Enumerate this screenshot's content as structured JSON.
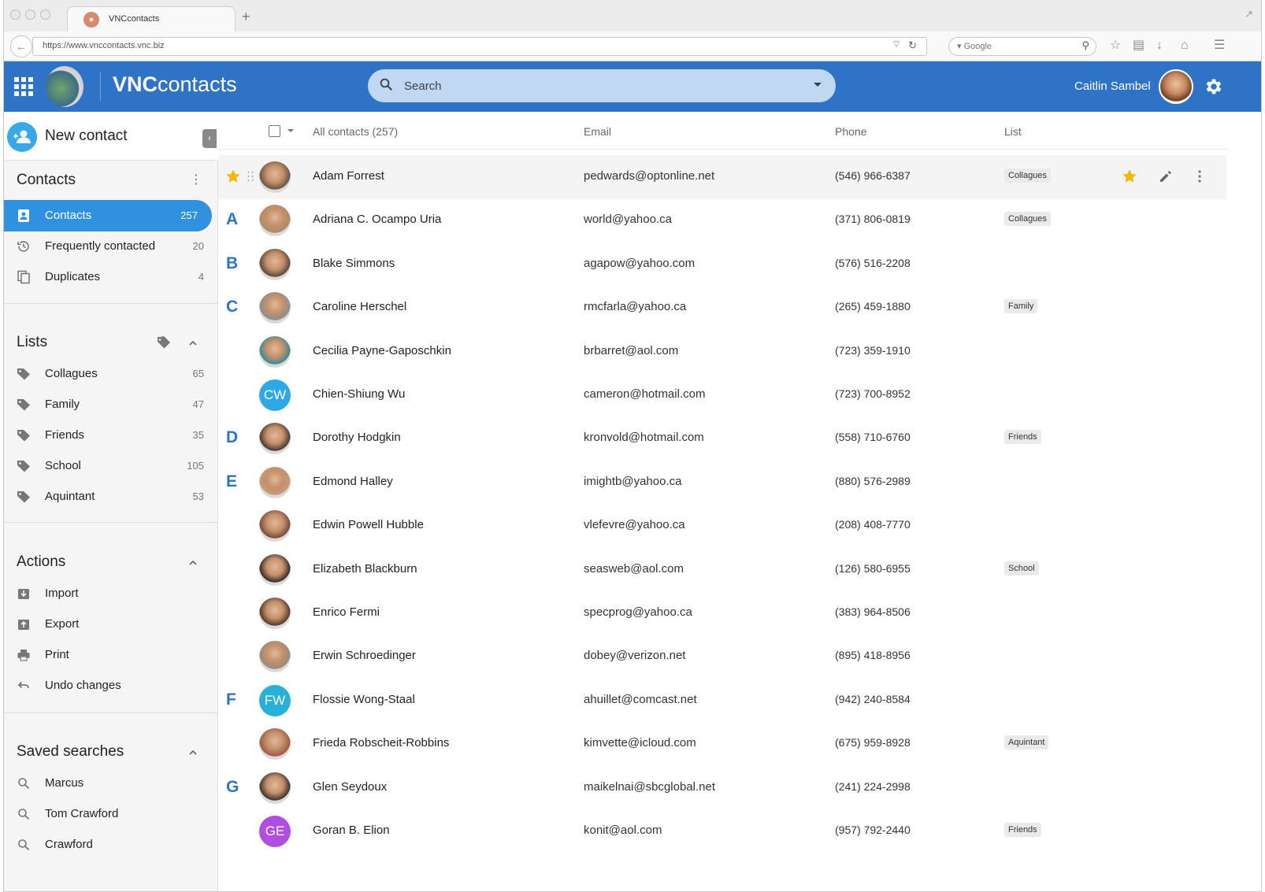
{
  "browser": {
    "tab_title": "VNCcontacts",
    "url": "https://www.vnccontacts.vnc.biz",
    "search_engine": "Google"
  },
  "header": {
    "app_title_bold": "VNC",
    "app_title_rest": "contacts",
    "search_placeholder": "Search",
    "user_name": "Caitlin Sambel",
    "brand_color": "#2f73c6"
  },
  "sidebar": {
    "new_contact_label": "New contact",
    "contacts_section": {
      "title": "Contacts",
      "items": [
        {
          "label": "Contacts",
          "count": "257",
          "icon": "contact-card-icon",
          "active": true
        },
        {
          "label": "Frequently contacted",
          "count": "20",
          "icon": "history-icon"
        },
        {
          "label": "Duplicates",
          "count": "4",
          "icon": "duplicate-icon"
        }
      ]
    },
    "lists_section": {
      "title": "Lists",
      "items": [
        {
          "label": "Collagues",
          "count": "65"
        },
        {
          "label": "Family",
          "count": "47"
        },
        {
          "label": "Friends",
          "count": "35"
        },
        {
          "label": "School",
          "count": "105"
        },
        {
          "label": "Aquintant",
          "count": "53"
        }
      ]
    },
    "actions_section": {
      "title": "Actions",
      "items": [
        {
          "label": "Import",
          "icon": "import-icon"
        },
        {
          "label": "Export",
          "icon": "export-icon"
        },
        {
          "label": "Print",
          "icon": "print-icon"
        },
        {
          "label": "Undo changes",
          "icon": "undo-icon"
        }
      ]
    },
    "saved_searches_section": {
      "title": "Saved searches",
      "items": [
        {
          "label": "Marcus"
        },
        {
          "label": "Tom Crawford"
        },
        {
          "label": "Crawford"
        }
      ]
    }
  },
  "table": {
    "headers": {
      "name": "All contacts (257)",
      "email": "Email",
      "phone": "Phone",
      "list": "List"
    },
    "rows": [
      {
        "letter": "",
        "name": "Adam Forrest",
        "email": "pedwards@optonline.net",
        "phone": "(546) 966-6387",
        "list": "Collagues",
        "avatar_initials": "",
        "avatar_color": "#6b5445",
        "starred": true
      },
      {
        "letter": "A",
        "name": "Adriana C. Ocampo Uria",
        "email": "world@yahoo.ca",
        "phone": "(371) 806-0819",
        "list": "Collagues",
        "avatar_initials": "",
        "avatar_color": "#b08a68"
      },
      {
        "letter": "B",
        "name": "Blake Simmons",
        "email": "agapow@yahoo.com",
        "phone": "(576) 516-2208",
        "list": "",
        "avatar_initials": "",
        "avatar_color": "#5c4a3e"
      },
      {
        "letter": "C",
        "name": "Caroline Herschel",
        "email": "rmcfarla@yahoo.ca",
        "phone": "(265) 459-1880",
        "list": "Family",
        "avatar_initials": "",
        "avatar_color": "#8d8d8d"
      },
      {
        "letter": "",
        "name": "Cecilia Payne-Gaposchkin",
        "email": "brbarret@aol.com",
        "phone": "(723) 359-1910",
        "list": "",
        "avatar_initials": "",
        "avatar_color": "#3b8a98"
      },
      {
        "letter": "",
        "name": "Chien-Shiung Wu",
        "email": "cameron@hotmail.com",
        "phone": "(723) 700-8952",
        "list": "",
        "avatar_initials": "CW",
        "avatar_color": "#2fa8e6"
      },
      {
        "letter": "D",
        "name": "Dorothy Hodgkin",
        "email": "kronvold@hotmail.com",
        "phone": "(558) 710-6760",
        "list": "Friends",
        "avatar_initials": "",
        "avatar_color": "#4a3a33"
      },
      {
        "letter": "E",
        "name": "Edmond Halley",
        "email": "imightb@yahoo.ca",
        "phone": "(880) 576-2989",
        "list": "",
        "avatar_initials": "",
        "avatar_color": "#c69a74"
      },
      {
        "letter": "",
        "name": "Edwin Powell Hubble",
        "email": "vlefevre@yahoo.ca",
        "phone": "(208) 408-7770",
        "list": "",
        "avatar_initials": "",
        "avatar_color": "#7a4a38"
      },
      {
        "letter": "",
        "name": "Elizabeth Blackburn",
        "email": "seasweb@aol.com",
        "phone": "(126) 580-6955",
        "list": "School",
        "avatar_initials": "",
        "avatar_color": "#3a2c28"
      },
      {
        "letter": "",
        "name": "Enrico Fermi",
        "email": "specprog@yahoo.ca",
        "phone": "(383) 964-8506",
        "list": "",
        "avatar_initials": "",
        "avatar_color": "#5a3a2a"
      },
      {
        "letter": "",
        "name": "Erwin Schroedinger",
        "email": "dobey@verizon.net",
        "phone": "(895) 418-8956",
        "list": "",
        "avatar_initials": "",
        "avatar_color": "#9a8a7a"
      },
      {
        "letter": "F",
        "name": "Flossie Wong-Staal",
        "email": "ahuillet@comcast.net",
        "phone": "(942) 240-8584",
        "list": "",
        "avatar_initials": "FW",
        "avatar_color": "#28b0d8"
      },
      {
        "letter": "",
        "name": "Frieda Robscheit-Robbins",
        "email": "kimvette@icloud.com",
        "phone": "(675) 959-8928",
        "list": "Aquintant",
        "avatar_initials": "",
        "avatar_color": "#a05a40"
      },
      {
        "letter": "G",
        "name": "Glen Seydoux",
        "email": "maikelnai@sbcglobal.net",
        "phone": "(241) 224-2998",
        "list": "",
        "avatar_initials": "",
        "avatar_color": "#3e3230"
      },
      {
        "letter": "",
        "name": "Goran B. Elion",
        "email": "konit@aol.com",
        "phone": "(957) 792-2440",
        "list": "Friends",
        "avatar_initials": "GE",
        "avatar_color": "#b04ee0"
      }
    ]
  },
  "colors": {
    "accent": "#2f73c6",
    "active_item": "#2f91e0",
    "star": "#f5b800",
    "new_contact": "#38a8e8"
  }
}
